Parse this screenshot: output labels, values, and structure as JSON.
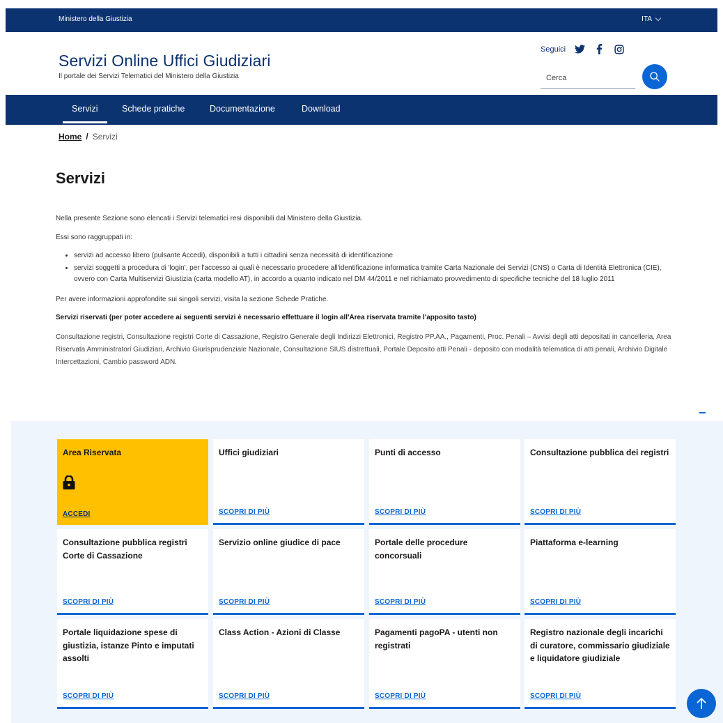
{
  "slim_header": {
    "ministry": "Ministero della Giustizia",
    "language": "ITA"
  },
  "brand": {
    "title": "Servizi Online Uffici Giudiziari",
    "subtitle": "Il portale dei Servizi Telematici del Ministero della Giustizia"
  },
  "social": {
    "label": "Seguici",
    "icons": [
      "twitter-icon",
      "facebook-icon",
      "instagram-icon"
    ]
  },
  "search": {
    "placeholder": "Cerca"
  },
  "nav": {
    "items": [
      "Servizi",
      "Schede pratiche",
      "Documentazione",
      "Download"
    ],
    "active": "Servizi"
  },
  "breadcrumb": {
    "home": "Home",
    "separator": "/",
    "current": "Servizi"
  },
  "page": {
    "title": "Servizi",
    "intro": "Nella presente Sezione sono elencati i Servizi telematici resi disponibili dal Ministero della Giustizia.",
    "grouped": "Essi sono raggruppati in:",
    "bullets": [
      "servizi ad accesso libero (pulsante Accedi), disponibili a tutti i cittadini senza necessità di identificazione",
      "servizi soggetti a procedura di 'login', per l'accesso ai quali è necessario procedere all'identificazione informatica tramite Carta Nazionale dei Servizi (CNS) o Carta di Identità Elettronica (CIE), ovvero con Carta Multiservizi Giustizia (carta modello AT), in accordo a quanto indicato nel DM 44/2011 e nel richiamato provvedimento di specifiche tecniche del 18 luglio 2011"
    ],
    "more_info": "Per avere informazioni approfondite sui singoli servizi, visita la sezione Schede Pratiche.",
    "reserved_title": "Servizi riservati (per poter accedere ai seguenti servizi è necessario effettuare il login all'Area riservata tramite l'apposito tasto)",
    "reserved_list": "Consultazione registri, Consultazione registri Corte di Cassazione, Registro Generale degli Indirizzi Elettronici, Registro PP.AA., Pagamenti, Proc. Penali – Avvisi degli atti depositati in cancelleria, Area Riservata Amministratori Giudiziari, Archivio Giurisprudenziale Nazionale, Consultazione SIUS distrettuali, Portale Deposito atti Penali - deposito con modalità telematica di atti penali, Archivio Digitale Intercettazioni, Cambio password ADN."
  },
  "cards": [
    {
      "title": "Area Riservata",
      "link": "ACCEDI"
    },
    {
      "title": "Uffici giudiziari",
      "link": "SCOPRI DI PIÙ"
    },
    {
      "title": "Punti di accesso",
      "link": "SCOPRI DI PIÙ"
    },
    {
      "title": "Consultazione pubblica dei registri",
      "link": "SCOPRI DI PIÙ"
    },
    {
      "title": "Consultazione pubblica registri Corte di Cassazione",
      "link": "SCOPRI DI PIÙ"
    },
    {
      "title": "Servizio online giudice di pace",
      "link": "SCOPRI DI PIÙ"
    },
    {
      "title": "Portale delle procedure concorsuali",
      "link": "SCOPRI DI PIÙ"
    },
    {
      "title": "Piattaforma e-learning",
      "link": "SCOPRI DI PIÙ"
    },
    {
      "title": "Portale liquidazione spese di giustizia, istanze Pinto e imputati assolti",
      "link": "SCOPRI DI PIÙ"
    },
    {
      "title": "Class Action - Azioni di Classe",
      "link": "SCOPRI DI PIÙ"
    },
    {
      "title": "Pagamenti pagoPA - utenti non registrati",
      "link": "SCOPRI DI PIÙ"
    },
    {
      "title": "Registro nazionale degli incarichi di curatore, commissario giudiziale e liquidatore giudiziale",
      "link": "SCOPRI DI PIÙ"
    }
  ],
  "colors": {
    "primary": "#0b3370",
    "accent": "#0a66d4",
    "highlight": "#ffc000",
    "section_bg": "#eef5fc"
  }
}
